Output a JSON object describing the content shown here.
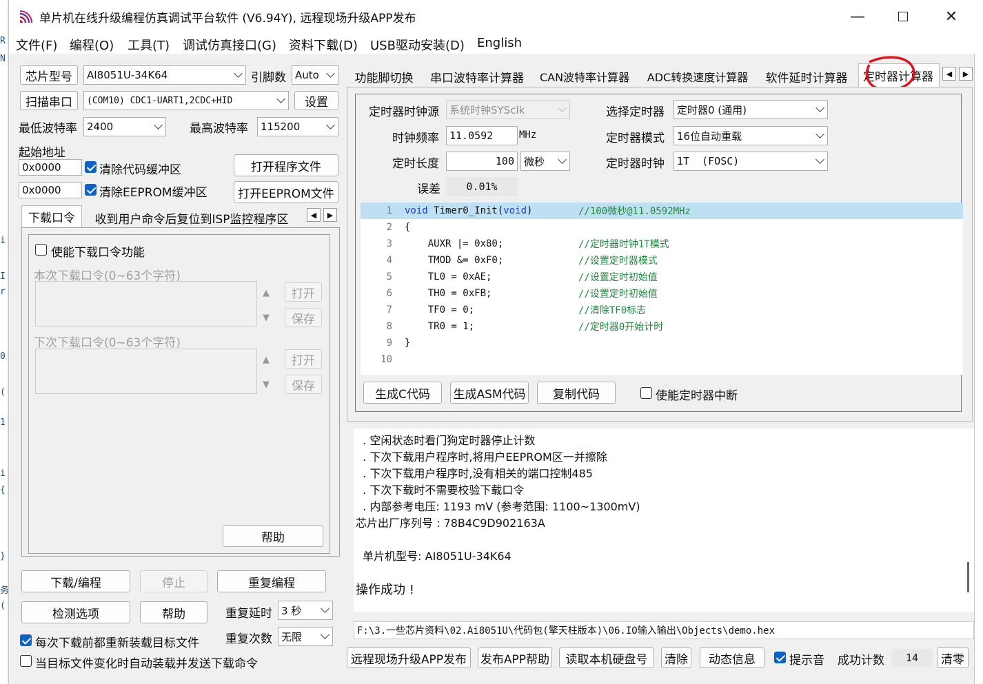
{
  "window": {
    "title": "单片机在线升级编程仿真调试平台软件 (V6.94Y), 远程现场升级APP发布"
  },
  "menu": [
    "文件(F)",
    "编程(O)",
    "工具(T)",
    "调试仿真接口(G)",
    "资料下载(D)",
    "USB驱动安装(D)",
    "English"
  ],
  "left": {
    "chip_label": "芯片型号",
    "chip_value": "AI8051U-34K64",
    "pin_label": "引脚数",
    "pin_value": "Auto",
    "scan_button": "扫描串口",
    "port_value": "(COM10) CDC1-UART1,2CDC+HID",
    "settings_button": "设置",
    "min_baud_label": "最低波特率",
    "min_baud": "2400",
    "max_baud_label": "最高波特率",
    "max_baud": "115200",
    "start_addr_label": "起始地址",
    "addr1": "0x0000",
    "clear_code_label": "清除代码缓冲区",
    "open_program_button": "打开程序文件",
    "addr2": "0x0000",
    "clear_eeprom_label": "清除EEPROM缓冲区",
    "open_eeprom_button": "打开EEPROM文件",
    "tabs": [
      "下载口令",
      "收到用户命令后复位到ISP监控程序区"
    ],
    "enable_cmd_label": "使能下载口令功能",
    "this_cmd_label": "本次下载口令(0~63个字符)",
    "next_cmd_label": "下次下载口令(0~63个字符)",
    "open": "打开",
    "save": "保存",
    "help": "帮助",
    "download_button": "下载/编程",
    "stop_button": "停止",
    "reprogram_button": "重复编程",
    "check_button": "检测选项",
    "help_button": "帮助",
    "repeat_delay_label": "重复延时",
    "repeat_delay": "3 秒",
    "repeat_count_label": "重复次数",
    "repeat_count": "无限",
    "reload_label": "每次下载前都重新装载目标文件",
    "auto_label": "当目标文件变化时自动装载并发送下载命令"
  },
  "right": {
    "tabs": [
      "功能脚切换",
      "串口波特率计算器",
      "CAN波特率计算器",
      "ADC转换速度计算器",
      "软件延时计算器",
      "定时器计算器"
    ],
    "timer": {
      "clock_src_label": "定时器时钟源",
      "clock_src": "系统时钟SYSclk",
      "select_label": "选择定时器",
      "select": "定时器0 (通用)",
      "freq_label": "时钟频率",
      "freq": "11.0592",
      "freq_unit": "MHz",
      "mode_label": "定时器模式",
      "mode": "16位自动重载",
      "len_label": "定时长度",
      "len": "100",
      "len_unit": "微秒",
      "clk_label": "定时器时钟",
      "clk": "1T  (FOSC)",
      "err_label": "误差",
      "err": "0.01%"
    },
    "code": [
      {
        "n": "1",
        "kw": "void",
        "t": " Timer0_Init(",
        "kw2": "void",
        "t2": ")",
        "c": "//100微秒@11.0592MHz"
      },
      {
        "n": "2",
        "t": "{",
        "c": ""
      },
      {
        "n": "3",
        "t": "    AUXR |= 0x80;",
        "c": "//定时器时钟1T模式"
      },
      {
        "n": "4",
        "t": "    TMOD &= 0xF0;",
        "c": "//设置定时器模式"
      },
      {
        "n": "5",
        "t": "    TL0 = 0xAE;",
        "c": "//设置定时初始值"
      },
      {
        "n": "6",
        "t": "    TH0 = 0xFB;",
        "c": "//设置定时初始值"
      },
      {
        "n": "7",
        "t": "    TF0 = 0;",
        "c": "//清除TF0标志"
      },
      {
        "n": "8",
        "t": "    TR0 = 1;",
        "c": "//定时器0开始计时"
      },
      {
        "n": "9",
        "t": "}",
        "c": ""
      },
      {
        "n": "10",
        "t": "",
        "c": ""
      }
    ],
    "gen_c": "生成C代码",
    "gen_asm": "生成ASM代码",
    "copy": "复制代码",
    "enable_int": "使能定时器中断",
    "log": [
      "  . 空闲状态时看门狗定时器停止计数",
      "  . 下次下载用户程序时,将用户EEPROM区一并擦除",
      "  . 下次下载用户程序时,没有相关的端口控制485",
      "  . 下次下载时不需要校验下载口令",
      "  . 内部参考电压: 1193 mV (参考范围: 1100~1300mV)",
      "芯片出厂序列号 : 78B4C9D902163A",
      "",
      "  单片机型号: AI8051U-34K64",
      "",
      "操作成功 !"
    ],
    "path": "F:\\3.一些芯片资料\\02.Ai8051U\\代码包(擎天柱版本)\\06.IO输入输出\\Objects\\demo.hex",
    "bottom": {
      "remote": "远程现场升级APP发布",
      "publish_help": "发布APP帮助",
      "read_disk": "读取本机硬盘号",
      "clear": "清除",
      "dynamic": "动态信息",
      "beep": "提示音",
      "success_label": "成功计数",
      "success_count": "14",
      "zero": "清零"
    }
  },
  "colors": {
    "accent": "#0b63c9",
    "code_comment": "#1e8a3c",
    "keyword": "#1a3fd0",
    "highlight": "#bfe0f2",
    "annotation": "#e0141a"
  }
}
